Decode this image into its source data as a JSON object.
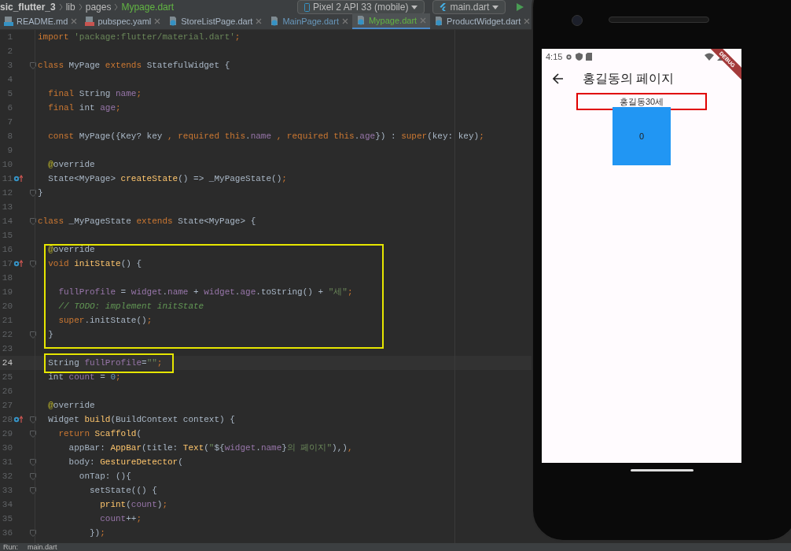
{
  "breadcrumb": [
    {
      "label": "sic_flutter_3",
      "kind": "project"
    },
    {
      "label": "lib",
      "kind": "folder"
    },
    {
      "label": "pages",
      "kind": "folder"
    },
    {
      "label": "Mypage.dart",
      "kind": "file"
    }
  ],
  "toolbar": {
    "device": "Pixel 2 API 33 (mobile)",
    "run_config": "main.dart"
  },
  "tabs": [
    {
      "label": "README.md",
      "kind": "markdown",
      "color": "#a9b7c6",
      "selected": false
    },
    {
      "label": "pubspec.yaml",
      "kind": "yaml",
      "color": "#a9b7c6",
      "selected": false
    },
    {
      "label": "StoreListPage.dart",
      "kind": "dart",
      "color": "#a9b7c6",
      "selected": false
    },
    {
      "label": "MainPage.dart",
      "kind": "dart",
      "color": "#6897bb",
      "selected": false
    },
    {
      "label": "Mypage.dart",
      "kind": "dart",
      "color": "#62b543",
      "selected": true
    },
    {
      "label": "ProductWidget.dart",
      "kind": "dart",
      "color": "#a9b7c6",
      "selected": false
    }
  ],
  "editor": {
    "lines": [
      {
        "number": "1",
        "current": false,
        "tokens": [
          {
            "kind": "keyword",
            "text": "import "
          },
          {
            "kind": "string",
            "text": "'package:flutter/material.dart'"
          },
          {
            "kind": "keyword",
            "text": ";"
          }
        ]
      },
      {
        "number": "2",
        "current": false
      },
      {
        "number": "3",
        "current": false,
        "gutter_icons": [
          {
            "kind": "fold"
          }
        ],
        "tokens": [
          {
            "kind": "keyword",
            "text": "class "
          },
          {
            "kind": "plain",
            "text": "MyPage "
          },
          {
            "kind": "keyword",
            "text": "extends "
          },
          {
            "kind": "plain",
            "text": "StatefulWidget {"
          }
        ]
      },
      {
        "number": "4",
        "current": false
      },
      {
        "number": "5",
        "current": false,
        "tokens": [
          {
            "kind": "keyword",
            "text": "  final "
          },
          {
            "kind": "plain",
            "text": "String "
          },
          {
            "kind": "field",
            "text": "name"
          },
          {
            "kind": "keyword",
            "text": ";"
          }
        ]
      },
      {
        "number": "6",
        "current": false,
        "tokens": [
          {
            "kind": "keyword",
            "text": "  final "
          },
          {
            "kind": "plain",
            "text": "int "
          },
          {
            "kind": "field",
            "text": "age"
          },
          {
            "kind": "keyword",
            "text": ";"
          }
        ]
      },
      {
        "number": "7",
        "current": false
      },
      {
        "number": "8",
        "current": false,
        "tokens": [
          {
            "kind": "keyword",
            "text": "  const "
          },
          {
            "kind": "plain",
            "text": "MyPage({Key? key "
          },
          {
            "kind": "keyword",
            "text": ", required this"
          },
          {
            "kind": "plain",
            "text": "."
          },
          {
            "kind": "field",
            "text": "name "
          },
          {
            "kind": "keyword",
            "text": ", required this"
          },
          {
            "kind": "plain",
            "text": "."
          },
          {
            "kind": "field",
            "text": "age"
          },
          {
            "kind": "plain",
            "text": "}) : "
          },
          {
            "kind": "keyword",
            "text": "super"
          },
          {
            "kind": "plain",
            "text": "(key: key)"
          },
          {
            "kind": "keyword",
            "text": ";"
          }
        ]
      },
      {
        "number": "9",
        "current": false
      },
      {
        "number": "10",
        "current": false,
        "tokens": [
          {
            "kind": "annotation",
            "text": "  @"
          },
          {
            "kind": "plain",
            "text": "override"
          }
        ]
      },
      {
        "number": "11",
        "current": false,
        "gutter_icons": [
          {
            "kind": "override"
          }
        ],
        "tokens": [
          {
            "kind": "plain",
            "text": "  State<MyPage> "
          },
          {
            "kind": "function",
            "text": "createState"
          },
          {
            "kind": "plain",
            "text": "() => _MyPageState()"
          },
          {
            "kind": "keyword",
            "text": ";"
          }
        ]
      },
      {
        "number": "12",
        "current": false,
        "gutter_icons": [
          {
            "kind": "fold"
          }
        ],
        "tokens": [
          {
            "kind": "plain",
            "text": "}"
          }
        ]
      },
      {
        "number": "13",
        "current": false
      },
      {
        "number": "14",
        "current": false,
        "gutter_icons": [
          {
            "kind": "fold"
          }
        ],
        "tokens": [
          {
            "kind": "keyword",
            "text": "class "
          },
          {
            "kind": "plain",
            "text": "_MyPageState "
          },
          {
            "kind": "keyword",
            "text": "extends "
          },
          {
            "kind": "plain",
            "text": "State<MyPage> {"
          }
        ]
      },
      {
        "number": "15",
        "current": false
      },
      {
        "number": "16",
        "current": false,
        "tokens": [
          {
            "kind": "annotation",
            "text": "  @"
          },
          {
            "kind": "plain",
            "text": "override"
          }
        ]
      },
      {
        "number": "17",
        "current": false,
        "gutter_icons": [
          {
            "kind": "override"
          },
          {
            "kind": "fold"
          }
        ],
        "tokens": [
          {
            "kind": "keyword",
            "text": "  void "
          },
          {
            "kind": "function",
            "text": "initState"
          },
          {
            "kind": "plain",
            "text": "() {"
          }
        ]
      },
      {
        "number": "18",
        "current": false
      },
      {
        "number": "19",
        "current": false,
        "tokens": [
          {
            "kind": "field",
            "text": "    fullProfile "
          },
          {
            "kind": "plain",
            "text": "= "
          },
          {
            "kind": "field",
            "text": "widget"
          },
          {
            "kind": "plain",
            "text": "."
          },
          {
            "kind": "field",
            "text": "name "
          },
          {
            "kind": "plain",
            "text": "+ "
          },
          {
            "kind": "field",
            "text": "widget"
          },
          {
            "kind": "plain",
            "text": "."
          },
          {
            "kind": "field",
            "text": "age"
          },
          {
            "kind": "plain",
            "text": ".toString() + "
          },
          {
            "kind": "string",
            "text": "\"세\""
          },
          {
            "kind": "keyword",
            "text": ";"
          }
        ]
      },
      {
        "number": "20",
        "current": false,
        "tokens": [
          {
            "kind": "comment",
            "text": "    // TODO: implement initState"
          }
        ]
      },
      {
        "number": "21",
        "current": false,
        "tokens": [
          {
            "kind": "keyword",
            "text": "    super"
          },
          {
            "kind": "plain",
            "text": ".initState()"
          },
          {
            "kind": "keyword",
            "text": ";"
          }
        ]
      },
      {
        "number": "22",
        "current": false,
        "gutter_icons": [
          {
            "kind": "fold"
          }
        ],
        "tokens": [
          {
            "kind": "plain",
            "text": "  }"
          }
        ]
      },
      {
        "number": "23",
        "current": false
      },
      {
        "number": "24",
        "current": true,
        "tokens": [
          {
            "kind": "plain",
            "text": "  String "
          },
          {
            "kind": "field",
            "text": "fullProfile"
          },
          {
            "kind": "plain",
            "text": "="
          },
          {
            "kind": "string",
            "text": "\"\""
          },
          {
            "kind": "keyword",
            "text": ";"
          }
        ]
      },
      {
        "number": "25",
        "current": false,
        "tokens": [
          {
            "kind": "plain",
            "text": "  int "
          },
          {
            "kind": "field",
            "text": "count "
          },
          {
            "kind": "plain",
            "text": "= "
          },
          {
            "kind": "number",
            "text": "0"
          },
          {
            "kind": "keyword",
            "text": ";"
          }
        ]
      },
      {
        "number": "26",
        "current": false
      },
      {
        "number": "27",
        "current": false,
        "tokens": [
          {
            "kind": "annotation",
            "text": "  @"
          },
          {
            "kind": "plain",
            "text": "override"
          }
        ]
      },
      {
        "number": "28",
        "current": false,
        "gutter_icons": [
          {
            "kind": "override"
          },
          {
            "kind": "fold"
          }
        ],
        "tokens": [
          {
            "kind": "plain",
            "text": "  Widget "
          },
          {
            "kind": "function",
            "text": "build"
          },
          {
            "kind": "plain",
            "text": "(BuildContext context) {"
          }
        ]
      },
      {
        "number": "29",
        "current": false,
        "gutter_icons": [
          {
            "kind": "fold"
          }
        ],
        "tokens": [
          {
            "kind": "keyword",
            "text": "    return "
          },
          {
            "kind": "function",
            "text": "Scaffold"
          },
          {
            "kind": "plain",
            "text": "("
          }
        ]
      },
      {
        "number": "30",
        "current": false,
        "tokens": [
          {
            "kind": "plain",
            "text": "      appBar: "
          },
          {
            "kind": "function",
            "text": "AppBar"
          },
          {
            "kind": "plain",
            "text": "(title: "
          },
          {
            "kind": "function",
            "text": "Text"
          },
          {
            "kind": "plain",
            "text": "("
          },
          {
            "kind": "string",
            "text": "\""
          },
          {
            "kind": "plain",
            "text": "${"
          },
          {
            "kind": "field",
            "text": "widget"
          },
          {
            "kind": "plain",
            "text": "."
          },
          {
            "kind": "field",
            "text": "name"
          },
          {
            "kind": "plain",
            "text": "}"
          },
          {
            "kind": "string",
            "text": "의 페이지\""
          },
          {
            "kind": "plain",
            "text": "),)"
          },
          {
            "kind": "keyword",
            "text": ","
          }
        ]
      },
      {
        "number": "31",
        "current": false,
        "gutter_icons": [
          {
            "kind": "fold"
          }
        ],
        "tokens": [
          {
            "kind": "plain",
            "text": "      body: "
          },
          {
            "kind": "function",
            "text": "GestureDetector"
          },
          {
            "kind": "plain",
            "text": "("
          }
        ]
      },
      {
        "number": "32",
        "current": false,
        "gutter_icons": [
          {
            "kind": "fold"
          }
        ],
        "tokens": [
          {
            "kind": "plain",
            "text": "        onTap: (){"
          }
        ]
      },
      {
        "number": "33",
        "current": false,
        "gutter_icons": [
          {
            "kind": "fold"
          }
        ],
        "tokens": [
          {
            "kind": "plain",
            "text": "          setState(() {"
          }
        ]
      },
      {
        "number": "34",
        "current": false,
        "tokens": [
          {
            "kind": "function",
            "text": "            print"
          },
          {
            "kind": "plain",
            "text": "("
          },
          {
            "kind": "field",
            "text": "count"
          },
          {
            "kind": "plain",
            "text": ")"
          },
          {
            "kind": "keyword",
            "text": ";"
          }
        ]
      },
      {
        "number": "35",
        "current": false,
        "tokens": [
          {
            "kind": "field",
            "text": "            count"
          },
          {
            "kind": "plain",
            "text": "++"
          },
          {
            "kind": "keyword",
            "text": ";"
          }
        ]
      },
      {
        "number": "36",
        "current": false,
        "gutter_icons": [
          {
            "kind": "fold"
          }
        ],
        "tokens": [
          {
            "kind": "plain",
            "text": "          })"
          },
          {
            "kind": "keyword",
            "text": ";"
          }
        ]
      }
    ]
  },
  "run_bar": {
    "label": "Run:",
    "tab": "main.dart"
  },
  "phone": {
    "status_time": "4:15",
    "banner": "DEBUG",
    "app_title": "홍길동의 페이지",
    "profile_text": "홍길동30세",
    "counter": "0"
  }
}
